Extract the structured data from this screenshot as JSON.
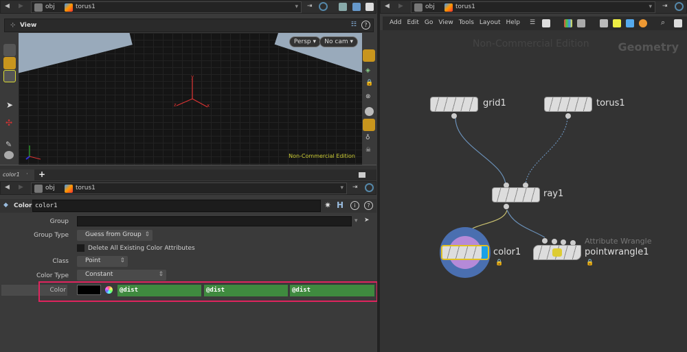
{
  "left_pane": {
    "path": {
      "root": "obj",
      "node": "torus1"
    },
    "viewer": {
      "title": "View",
      "persp_label": "Persp",
      "cam_label": "No cam",
      "watermark": "Non-Commercial Edition",
      "axis_labels": {
        "x": "x",
        "y": "y",
        "z": "z"
      }
    },
    "tab": {
      "label": "color1",
      "add_label": "+"
    },
    "param_path": {
      "root": "obj",
      "node": "torus1"
    },
    "node_header": {
      "type_label": "Color",
      "name": "color1"
    },
    "params": {
      "group_label": "Group",
      "group_value": "",
      "group_type_label": "Group Type",
      "group_type_value": "Guess from Group",
      "delete_attrs_label": "Delete All Existing Color Attributes",
      "delete_attrs_checked": false,
      "class_label": "Class",
      "class_value": "Point",
      "color_type_label": "Color Type",
      "color_type_value": "Constant",
      "color_label": "Color",
      "color_swatch": "#000000",
      "color_values": [
        "@dist",
        "@dist",
        "@dist"
      ]
    },
    "highlight_color": "#e0245e"
  },
  "right_pane": {
    "path": {
      "root": "obj",
      "node": "torus1"
    },
    "menu": [
      "Add",
      "Edit",
      "Go",
      "View",
      "Tools",
      "Layout",
      "Help"
    ],
    "watermark": "Non-Commercial Edition",
    "context_label": "Geometry",
    "nodes": [
      {
        "name": "grid1"
      },
      {
        "name": "torus1"
      },
      {
        "name": "ray1"
      },
      {
        "name": "color1",
        "selected": true
      },
      {
        "name": "pointwrangle1",
        "type_label": "Attribute Wrangle"
      }
    ]
  }
}
